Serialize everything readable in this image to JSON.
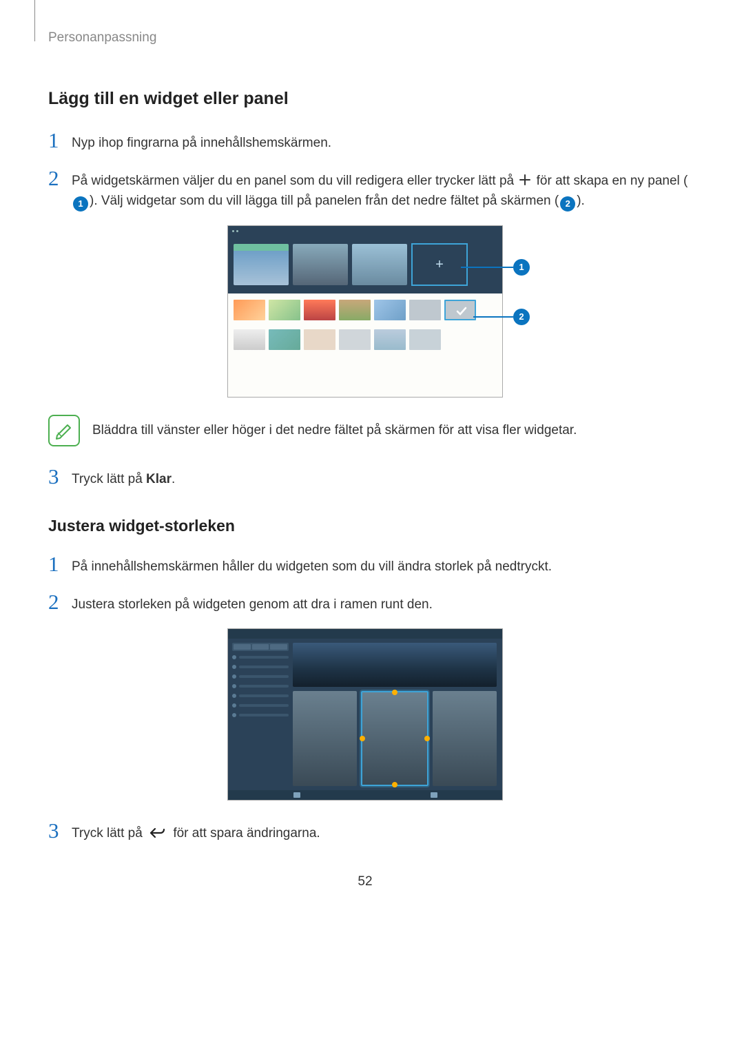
{
  "breadcrumb": "Personanpassning",
  "section1": {
    "title": "Lägg till en widget eller panel",
    "step1": {
      "num": "1",
      "text": "Nyp ihop fingrarna på innehållshemskärmen."
    },
    "step2": {
      "num": "2",
      "part_a": "På widgetskärmen väljer du en panel som du vill redigera eller trycker lätt på ",
      "part_b": " för att skapa en ny panel (",
      "part_c": "). Välj widgetar som du vill lägga till på panelen från det nedre fältet på skärmen (",
      "part_d": ")."
    },
    "badge1": "1",
    "badge2": "2",
    "note": "Bläddra till vänster eller höger i det nedre fältet på skärmen för att visa fler widgetar.",
    "step3": {
      "num": "3",
      "text_a": "Tryck lätt på ",
      "bold": "Klar",
      "text_b": "."
    }
  },
  "section2": {
    "title": "Justera widget-storleken",
    "step1": {
      "num": "1",
      "text": "På innehållshemskärmen håller du widgeten som du vill ändra storlek på nedtryckt."
    },
    "step2": {
      "num": "2",
      "text": "Justera storleken på widgeten genom att dra i ramen runt den."
    },
    "step3": {
      "num": "3",
      "text_a": "Tryck lätt på ",
      "text_b": " för att spara ändringarna."
    }
  },
  "callouts": {
    "c1": "1",
    "c2": "2"
  },
  "page_number": "52"
}
